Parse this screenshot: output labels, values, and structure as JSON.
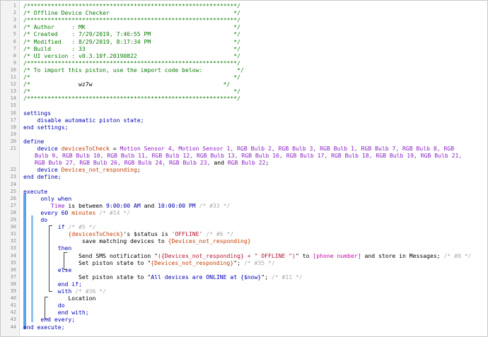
{
  "window": {
    "title": ""
  },
  "lines": [
    {
      "n": "1",
      "parts": [
        {
          "t": "/*************************************************************/",
          "c": "com"
        }
      ]
    },
    {
      "n": "2",
      "parts": [
        {
          "t": "/* Offline Device Checker                                    */",
          "c": "com"
        }
      ]
    },
    {
      "n": "3",
      "parts": [
        {
          "t": "/*************************************************************/",
          "c": "com"
        }
      ]
    },
    {
      "n": "4",
      "parts": [
        {
          "t": "/* Author     : MK                                           */",
          "c": "com"
        }
      ]
    },
    {
      "n": "5",
      "parts": [
        {
          "t": "/* Created    : 7/29/2019, 7:46:55 PM                        */",
          "c": "com"
        }
      ]
    },
    {
      "n": "6",
      "parts": [
        {
          "t": "/* Modified   : 8/29/2019, 8:17:34 PM                        */",
          "c": "com"
        }
      ]
    },
    {
      "n": "7",
      "parts": [
        {
          "t": "/* Build      : 33                                           */",
          "c": "com"
        }
      ]
    },
    {
      "n": "8",
      "parts": [
        {
          "t": "/* UI version : v0.3.10f.20190822                            */",
          "c": "com"
        }
      ]
    },
    {
      "n": "9",
      "parts": [
        {
          "t": "/*************************************************************/",
          "c": "com"
        }
      ]
    },
    {
      "n": "10",
      "parts": [
        {
          "t": "/* To import this piston, use the import code below:          */",
          "c": "com"
        }
      ]
    },
    {
      "n": "11",
      "parts": [
        {
          "t": "/*                                                           */",
          "c": "com"
        }
      ]
    },
    {
      "n": "12",
      "parts": [
        {
          "t": "/*              ",
          "c": "com"
        },
        {
          "t": "wz7w",
          "c": "big"
        },
        {
          "t": "                                      */",
          "c": "com"
        }
      ]
    },
    {
      "n": "13",
      "parts": [
        {
          "t": "/*                                                           */",
          "c": "com"
        }
      ]
    },
    {
      "n": "14",
      "parts": [
        {
          "t": "/*************************************************************/",
          "c": "com"
        }
      ]
    },
    {
      "n": "15",
      "parts": []
    },
    {
      "n": "16",
      "parts": [
        {
          "t": "settings",
          "c": "kw"
        }
      ]
    },
    {
      "n": "17",
      "parts": [
        {
          "t": "    disable automatic piston state;",
          "c": "kw"
        }
      ]
    },
    {
      "n": "18",
      "parts": [
        {
          "t": "end settings;",
          "c": "kw"
        }
      ]
    },
    {
      "n": "19",
      "parts": []
    },
    {
      "n": "20",
      "parts": [
        {
          "t": "define",
          "c": "kw"
        }
      ]
    },
    {
      "n": "21",
      "wrap": true,
      "parts": [
        {
          "t": "    device ",
          "c": "kw"
        },
        {
          "t": "devicesToCheck",
          "c": "var"
        },
        {
          "t": " = ",
          "c": "pl"
        },
        {
          "t": "Motion Sensor 4, Motion Sensor 1, RGB Bulb 2, RGB Bulb 3, RGB Bulb 1, RGB Bulb 7, RGB Bulb 8, RGB Bulb 9, RGB Bulb 10, RGB Bulb 11, RGB Bulb 12, RGB Bulb 13, RGB Bulb 16, RGB Bulb 17, RGB Bulb 18, RGB Bulb 19, RGB Bulb 21, RGB Bulb 27, RGB Bulb 26, RGB Bulb 24, RGB Bulb 23,",
          "c": "dev"
        },
        {
          "t": " and ",
          "c": "pl"
        },
        {
          "t": "RGB Bulb 22",
          "c": "dev"
        },
        {
          "t": ";",
          "c": "pl"
        }
      ]
    },
    {
      "n": "22",
      "parts": [
        {
          "t": "    device ",
          "c": "kw"
        },
        {
          "t": "Devices_not_responding",
          "c": "var"
        },
        {
          "t": ";",
          "c": "pl"
        }
      ]
    },
    {
      "n": "23",
      "parts": [
        {
          "t": "end define;",
          "c": "kw"
        }
      ]
    },
    {
      "n": "24",
      "parts": []
    },
    {
      "n": "25",
      "parts": [
        {
          "t": "execute",
          "c": "kw"
        }
      ]
    },
    {
      "n": "26",
      "parts": [
        {
          "t": "     only when",
          "c": "kw"
        }
      ]
    },
    {
      "n": "27",
      "parts": [
        {
          "t": "        Time",
          "c": "dev"
        },
        {
          "t": " is between ",
          "c": "pl"
        },
        {
          "t": "9:00:00 AM",
          "c": "tim"
        },
        {
          "t": " and ",
          "c": "pl"
        },
        {
          "t": "10:00:00 PM",
          "c": "tim"
        },
        {
          "t": " /* #33 */",
          "c": "cm2"
        }
      ]
    },
    {
      "n": "28",
      "parts": [
        {
          "t": "     every ",
          "c": "kw"
        },
        {
          "t": "60",
          "c": "tim"
        },
        {
          "t": " minutes",
          "c": "var"
        },
        {
          "t": " /* #14 */",
          "c": "cm2"
        }
      ]
    },
    {
      "n": "29",
      "parts": [
        {
          "t": "     do",
          "c": "kw"
        }
      ]
    },
    {
      "n": "30",
      "parts": [
        {
          "t": "          if",
          "c": "kw"
        },
        {
          "t": " /* #5 */",
          "c": "cm2"
        }
      ]
    },
    {
      "n": "31",
      "parts": [
        {
          "t": "             {devicesToCheck}",
          "c": "var"
        },
        {
          "t": "'s ",
          "c": "pl"
        },
        {
          "t": "$status",
          "c": "pl"
        },
        {
          "t": " is ",
          "c": "pl"
        },
        {
          "t": "'OFFLINE'",
          "c": "str"
        },
        {
          "t": " /* #6 */",
          "c": "cm2"
        }
      ]
    },
    {
      "n": "32",
      "parts": [
        {
          "t": "                 save matching devices to ",
          "c": "pl"
        },
        {
          "t": "{Devices_not_responding}",
          "c": "var"
        }
      ]
    },
    {
      "n": "33",
      "parts": [
        {
          "t": "          then",
          "c": "kw"
        }
      ]
    },
    {
      "n": "34",
      "parts": [
        {
          "t": "                Send SMS notification \"",
          "c": "pl"
        },
        {
          "t": "({Devices_not_responding} + \" OFFLINE \")",
          "c": "str"
        },
        {
          "t": "\" to ",
          "c": "pl"
        },
        {
          "t": "[phone number]",
          "c": "ph"
        },
        {
          "t": " and store in Messages;",
          "c": "pl"
        },
        {
          "t": " /* #8 */",
          "c": "cm2"
        }
      ]
    },
    {
      "n": "35",
      "parts": [
        {
          "t": "                Set piston state to \"",
          "c": "pl"
        },
        {
          "t": "{Devices_not_responding}",
          "c": "var"
        },
        {
          "t": "\";",
          "c": "pl"
        },
        {
          "t": " /* #35 */",
          "c": "cm2"
        }
      ]
    },
    {
      "n": "36",
      "parts": [
        {
          "t": "          else",
          "c": "kw"
        }
      ]
    },
    {
      "n": "37",
      "parts": [
        {
          "t": "                Set piston state to \"",
          "c": "pl"
        },
        {
          "t": "All devices are ONLINE at {$now}",
          "c": "kw"
        },
        {
          "t": "\";",
          "c": "pl"
        },
        {
          "t": " /* #11 */",
          "c": "cm2"
        }
      ]
    },
    {
      "n": "38",
      "parts": [
        {
          "t": "          end if;",
          "c": "kw"
        }
      ]
    },
    {
      "n": "39",
      "parts": [
        {
          "t": "          with",
          "c": "kw"
        },
        {
          "t": " /* #36 */",
          "c": "cm2"
        }
      ]
    },
    {
      "n": "40",
      "parts": [
        {
          "t": "             Location",
          "c": "pl"
        }
      ]
    },
    {
      "n": "41",
      "parts": [
        {
          "t": "          do",
          "c": "kw"
        }
      ]
    },
    {
      "n": "42",
      "parts": [
        {
          "t": "          end with;",
          "c": "kw"
        }
      ]
    },
    {
      "n": "43",
      "parts": [
        {
          "t": "     end every;",
          "c": "kw"
        }
      ]
    },
    {
      "n": "44",
      "parts": [
        {
          "t": "end execute;",
          "c": "kw"
        }
      ]
    }
  ],
  "colors": {
    "comment": "#0c7d06",
    "keyword": "#0000b5",
    "device": "#8a1fc4",
    "variable": "#c43d00",
    "string": "#b5102b",
    "placeholder": "#c20aa8",
    "gutter": "#f3f3f3",
    "block_marker": "#5aa4e6"
  }
}
